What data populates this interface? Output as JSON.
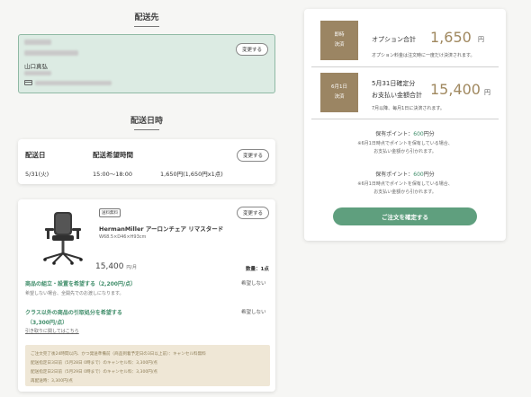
{
  "shipping": {
    "title": "配送先",
    "name": "山口真弘",
    "change_label": "変更する"
  },
  "delivery": {
    "title": "配送日時",
    "date_header": "配送日",
    "time_header": "配送希望時間",
    "date": "5/31(火)",
    "time": "15:00〜18:00",
    "price": "1,650円(1,650円x1点)",
    "change_label": "変更する"
  },
  "product": {
    "badge": "送料無料",
    "name": "HermanMiller アーロンチェア リマスタード",
    "size": "W68.5×D46×H93cm",
    "price": "15,400",
    "price_unit": "円/月",
    "qty": "数量：1点",
    "change_label": "変更する",
    "option1_title": "商品の組立・設置を希望する（2,200円/点）",
    "option1_sub": "希望しない場合、全開先でのお渡しになります。",
    "option1_state": "希望しない",
    "option2_title": "クラス以外の商品の引取処分を希望する",
    "option2_price": "（3,300円/点）",
    "option2_state": "希望しない",
    "option2_link": "引き取りに関してはこちら",
    "notice": [
      "ご注文完了後24時間以内、かつ発送準備前（商品到着予定日の3日以上前）：キャンセル料無料",
      "配送指定日3日前（5月28日 0時まで）のキャンセル料：3,300円/点",
      "配送指定日2日前（5月29日 0時まで）のキャンセル料：3,300円/点",
      "再配送時：3,300円/点"
    ]
  },
  "summary": {
    "immediate_tag_line1": "即時",
    "immediate_tag_line2": "決済",
    "option_total_label": "オプション合計",
    "option_total_amount": "1,650",
    "yen": "円",
    "option_note": "オプション料金は注文時に一度だけ決済されます。",
    "june_tag_line1": "6月1日",
    "june_tag_line2": "決済",
    "monthly_label1": "5月31日確定分",
    "monthly_label2": "お支払い金額合計",
    "monthly_amount": "15,400",
    "monthly_note": "7月以降、毎月1日に決済されます。",
    "points_label": "保有ポイント：",
    "points_value": "600",
    "points_unit": "円分",
    "points_note1": "※6月1日時点でポイントを保有している場合、",
    "points_note2": "お支払い金額から引かれます。",
    "confirm_label": "ご注文を確定する"
  },
  "colors": {
    "accent_green": "#5f9f7e",
    "accent_gold": "#9b8563"
  }
}
